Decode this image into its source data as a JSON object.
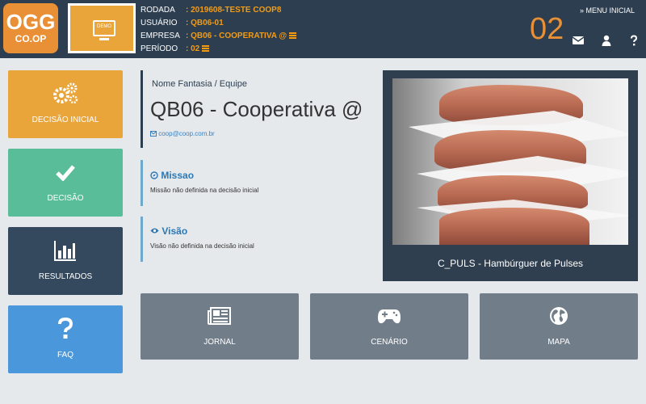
{
  "header": {
    "logo_top": "OGG",
    "logo_bottom": "CO.OP",
    "demo_label": "DEMO",
    "info": [
      {
        "key": "RODADA",
        "value": ": 2019608-TESTE COOP8",
        "list_icon": false
      },
      {
        "key": "USUÁRIO",
        "value": ": QB06-01",
        "list_icon": false
      },
      {
        "key": "EMPRESA",
        "value": ": QB06 - COOPERATIVA @",
        "list_icon": true
      },
      {
        "key": "PERÍODO",
        "value": ": 02",
        "list_icon": true
      }
    ],
    "round_number": "02",
    "menu_inicial": "» MENU INICIAL",
    "icons": [
      "envelope-icon",
      "user-icon",
      "question-icon"
    ]
  },
  "sidebar": {
    "items": [
      {
        "label": "DECISÃO INICIAL",
        "icon": "gears-icon",
        "color": "#e9a53a"
      },
      {
        "label": "DECISÃO",
        "icon": "check-icon",
        "color": "#59bd9a"
      },
      {
        "label": "RESULTADOS",
        "icon": "bar-chart-icon",
        "color": "#34495e"
      },
      {
        "label": "FAQ",
        "icon": "question-icon",
        "color": "#4a97dc"
      }
    ]
  },
  "company": {
    "label": "Nome Fantasia / Equipe",
    "name": "QB06 - Cooperativa @",
    "email": "coop@coop.com.br"
  },
  "missao": {
    "title": "Missao",
    "text": "Missão não definida na decisão inicial"
  },
  "visao": {
    "title": "Visão",
    "text": "Visão não definida na decisão inicial"
  },
  "product": {
    "name": "C_PULS - Hambúrguer de Pulses"
  },
  "tiles": [
    {
      "label": "JORNAL",
      "icon": "newspaper-icon"
    },
    {
      "label": "CENÁRIO",
      "icon": "gamepad-icon"
    },
    {
      "label": "MAPA",
      "icon": "globe-icon"
    }
  ],
  "colors": {
    "header_bg": "#2c3e50",
    "accent_orange": "#e98f35",
    "link_blue": "#2a78b5",
    "tile_gray": "#727d8a"
  }
}
